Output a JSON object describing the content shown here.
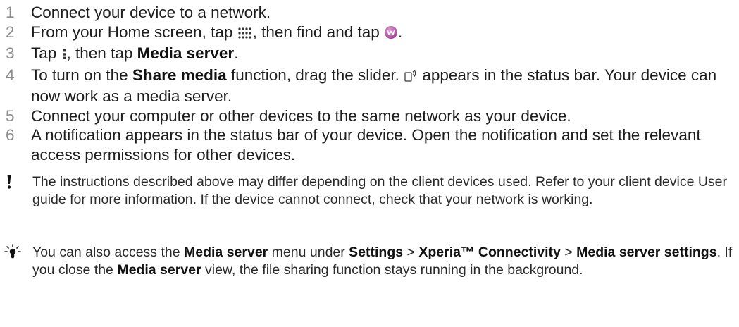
{
  "steps": [
    {
      "num": "1",
      "parts": [
        {
          "t": "Connect your device to a network."
        }
      ]
    },
    {
      "num": "2",
      "parts": [
        {
          "t": "From your Home screen, tap "
        },
        {
          "icon": "apps-grid-icon"
        },
        {
          "t": ", then find and tap "
        },
        {
          "icon": "walkman-app-icon"
        },
        {
          "t": "."
        }
      ]
    },
    {
      "num": "3",
      "parts": [
        {
          "t": "Tap "
        },
        {
          "icon": "overflow-menu-icon"
        },
        {
          "t": ", then tap "
        },
        {
          "b": "Media server"
        },
        {
          "t": "."
        }
      ]
    },
    {
      "num": "4",
      "parts": [
        {
          "t": "To turn on the "
        },
        {
          "b": "Share media"
        },
        {
          "t": " function, drag the slider. "
        },
        {
          "icon": "media-server-status-icon"
        },
        {
          "t": " appears in the status bar. Your device can now work as a media server."
        }
      ]
    },
    {
      "num": "5",
      "parts": [
        {
          "t": "Connect your computer or other devices to the same network as your device."
        }
      ]
    },
    {
      "num": "6",
      "parts": [
        {
          "t": "A notification appears in the status bar of your device. Open the notification and set the relevant access permissions for other devices."
        }
      ]
    }
  ],
  "note": {
    "icon": "exclamation-icon",
    "text": "The instructions described above may differ depending on the client devices used. Refer to your client device User guide for more information. If the device cannot connect, check that your network is working."
  },
  "tip": {
    "icon": "lightbulb-icon",
    "parts": [
      {
        "t": "You can also access the "
      },
      {
        "b": "Media server"
      },
      {
        "t": " menu under "
      },
      {
        "b": "Settings"
      },
      {
        "t": " > "
      },
      {
        "b": "Xperia™ Connectivity"
      },
      {
        "t": " > "
      },
      {
        "b": "Media server settings"
      },
      {
        "t": ". If you close the "
      },
      {
        "b": "Media server"
      },
      {
        "t": " view, the file sharing function stays running in the background."
      }
    ]
  },
  "colors": {
    "walkman_icon": "#b04fa8",
    "step_number": "#8c8c8c"
  }
}
